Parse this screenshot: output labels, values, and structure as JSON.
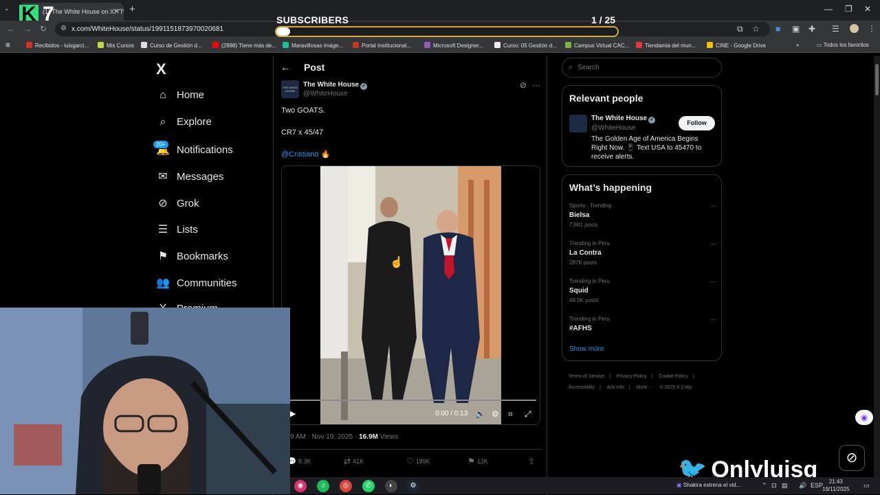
{
  "browser": {
    "tab_title": "(1) The White House on X: \"Tw",
    "url": "x.com/WhiteHouse/status/1991151873970020681",
    "bookmarks": [
      {
        "label": "Recibidos - luisgarci...",
        "color": "#d93025"
      },
      {
        "label": "Mis Cursos",
        "color": "#c6d643"
      },
      {
        "label": "Curso de Gestión d...",
        "color": "#e0e0e0"
      },
      {
        "label": "(2888) Tiene más de...",
        "color": "#ff0000"
      },
      {
        "label": "Maravillosas imáge...",
        "color": "#1abc9c"
      },
      {
        "label": "Portal Institucional...",
        "color": "#c0392b"
      },
      {
        "label": "Microsoft Designer...",
        "color": "#9b59b6"
      },
      {
        "label": "Curso: 05 Gestión d...",
        "color": "#eeeeee"
      },
      {
        "label": "Campus Virtual CAC...",
        "color": "#7cb342"
      },
      {
        "label": "Tiendamia del mun...",
        "color": "#e53935"
      },
      {
        "label": "CINE - Google Drive",
        "color": "#fbbc04"
      }
    ],
    "all_bookmarks": "Todos los favoritos"
  },
  "overlay": {
    "subscribers_label": "SUBSCRIBERS",
    "subscribers_count": "1  / 25",
    "progress_fraction": 0.04,
    "logo_k": "K",
    "logo_7": "7"
  },
  "sidebar": {
    "logo": "X",
    "notif_badge": "20+",
    "items": [
      {
        "label": "Home",
        "icon": "⌂"
      },
      {
        "label": "Explore",
        "icon": "⌕"
      },
      {
        "label": "Notifications",
        "icon": "🔔"
      },
      {
        "label": "Messages",
        "icon": "✉"
      },
      {
        "label": "Grok",
        "icon": "⊘"
      },
      {
        "label": "Lists",
        "icon": "☰"
      },
      {
        "label": "Bookmarks",
        "icon": "⚑"
      },
      {
        "label": "Communities",
        "icon": "👥"
      },
      {
        "label": "Premium",
        "icon": "X"
      }
    ]
  },
  "post": {
    "header": "Post",
    "author_name": "The White House",
    "author_handle": "@WhiteHouse",
    "avatar_text": "THE WHITE HOUSE",
    "line1": "Two GOATS.",
    "line2": "CR7 x 45/47",
    "mention": "@Cristiano 🔥",
    "video_time": "0:00 / 0:13",
    "meta_time": "9 AM · Nov 19, 2025 · ",
    "views_count": "16.9M",
    "views_label": " Views",
    "replies": "8.3K",
    "reposts": "41K",
    "likes": "189K",
    "bookmarks": "12K"
  },
  "right": {
    "search_placeholder": "Search",
    "relevant_title": "Relevant people",
    "rp_name": "The White House",
    "rp_handle": "@WhiteHouse",
    "rp_bio": "The Golden Age of America Begins Right Now. 📱 Text USA to 45470 to receive alerts.",
    "follow_label": "Follow",
    "happening_title": "What’s happening",
    "trends": [
      {
        "context": "Sports · Trending",
        "name": "Bielsa",
        "posts": "7,981 posts"
      },
      {
        "context": "Trending in Peru",
        "name": "La Contra",
        "posts": "287K posts"
      },
      {
        "context": "Trending in Peru",
        "name": "Squid",
        "posts": "49.5K posts"
      },
      {
        "context": "Trending in Peru",
        "name": "#AFHS",
        "posts": ""
      }
    ],
    "show_more": "Show more",
    "footer": [
      "Terms of Service",
      "|",
      "Privacy Policy",
      "|",
      "Cookie Policy",
      "|",
      "Accessibility",
      "|",
      "Ads info",
      "|",
      "More ···",
      "© 2025 X Corp."
    ]
  },
  "branding": {
    "name": "Onlyluisg"
  },
  "taskbar": {
    "news": "Shakira estrena el vid...",
    "lang": "ESP",
    "time": "21:43",
    "date": "19/11/2025"
  }
}
